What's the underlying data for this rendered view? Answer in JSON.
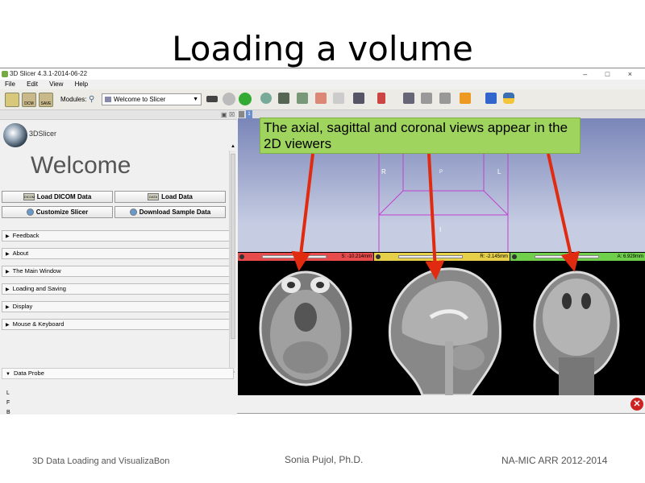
{
  "slide": {
    "title": "Loading a volume",
    "footer_left": "3D Data Loading and VisualizaBon",
    "footer_center": "Sonia Pujol, Ph.D.",
    "footer_right": "NA-MIC ARR 2012-2014"
  },
  "window": {
    "title": "3D Slicer 4.3.1-2014-06-22",
    "controls": "– □ ×"
  },
  "menu": [
    "File",
    "Edit",
    "View",
    "Help"
  ],
  "toolbar": {
    "modules_label": "Modules:",
    "module_selected": "Welcome to Slicer",
    "left_icon_labels": [
      "DCM",
      "DATA",
      "SAVE"
    ],
    "icons": [
      "data-icon",
      "dicom-icon",
      "save-icon",
      "search-icon",
      "history-icon",
      "back-icon",
      "forward-icon",
      "layout-icon",
      "crosshair-icon",
      "python-icon"
    ]
  },
  "panel": {
    "logo_text": "3DSlicer",
    "welcome": "Welcome",
    "buttons": {
      "load_dicom": "Load DICOM Data",
      "load_data": "Load Data",
      "customize": "Customize Slicer",
      "download_sample": "Download Sample Data",
      "dicom_icon_text": "DICOM",
      "data_icon_text": "DATA"
    },
    "sections": [
      "Feedback",
      "About",
      "The Main Window",
      "Loading and Saving",
      "Display",
      "Mouse & Keyboard"
    ],
    "data_probe": "Data Probe",
    "probe_labels": [
      "L",
      "F",
      "B"
    ]
  },
  "viewers": {
    "tab_label": "1",
    "cube_labels": {
      "r": "R",
      "p": "P",
      "l": "L",
      "i": "I"
    },
    "red_value": "S: -10.214mm",
    "yellow_value": "R: -2.145mm",
    "green_value": "A: 6.929mm"
  },
  "callout": {
    "text": "The axial, sagittal and coronal views appear in the 2D viewers"
  },
  "colors": {
    "red_slice": "#e84b4b",
    "yellow_slice": "#e6d04a",
    "green_slice": "#6fcf4a",
    "callout": "#9fd45f",
    "arrow": "#e02b10"
  }
}
